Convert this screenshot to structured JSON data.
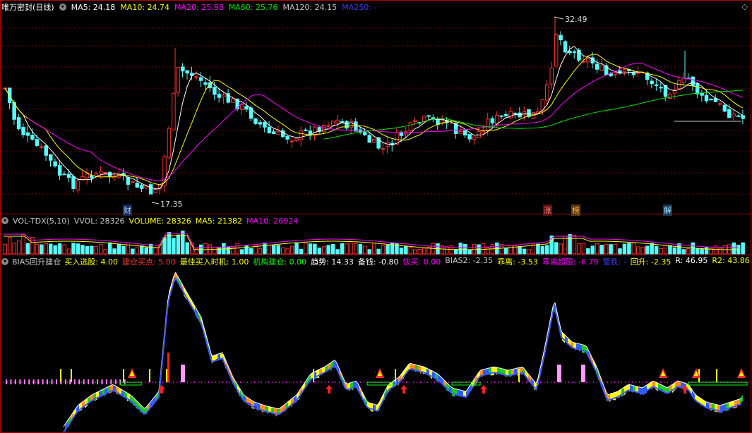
{
  "colors": {
    "up": "#ff3232",
    "down": "#54fcfc",
    "ma5": "#ffffff",
    "ma10": "#ffff00",
    "ma20": "#ff00ff",
    "ma60": "#00e600",
    "ma120": "#c8c8c8",
    "ma250": "#1e1eff",
    "grid": "#7a0000",
    "axis": "#b00000"
  },
  "header": {
    "title": "唯万密封(日线)",
    "ma": [
      {
        "label": "MA5: 24.18",
        "color": "#ffffff"
      },
      {
        "label": "MA10: 24.74",
        "color": "#ffff00"
      },
      {
        "label": "MA20: 25.98",
        "color": "#ff00ff"
      },
      {
        "label": "MA60: 25.76",
        "color": "#00e600"
      },
      {
        "label": "MA120: 24.15",
        "color": "#c8c8c8"
      },
      {
        "label": "MA250: -",
        "color": "#3a3aff"
      }
    ],
    "high_label": "32.49",
    "low_label": "17.35",
    "markers": [
      {
        "text": "财",
        "bg": "#1a2a55",
        "fg": "#9fd0ff"
      },
      {
        "text": "涨",
        "bg": "#5a1010",
        "fg": "#ff8080"
      },
      {
        "text": "榜",
        "bg": "#5a3a10",
        "fg": "#ffb040"
      },
      {
        "text": "解",
        "bg": "#1a3a55",
        "fg": "#9fe0ff"
      }
    ]
  },
  "volume": {
    "title": "VOL-TDX(5,10)",
    "items": [
      {
        "label": "VVOL: 28326",
        "color": "#c8c8c8"
      },
      {
        "label": "VOLUME: 28326",
        "color": "#ffff00"
      },
      {
        "label": "MA5: 21382",
        "color": "#ffff00"
      },
      {
        "label": "MA10: 26924",
        "color": "#ff00ff"
      }
    ]
  },
  "bias": {
    "title": "BIAS回升建仓",
    "items": [
      {
        "label": "买入选股: 4.00",
        "color": "#ffff00"
      },
      {
        "label": "建仓买点: 5.00",
        "color": "#ff3232"
      },
      {
        "label": "最佳买入时机: 1.00",
        "color": "#ffff00"
      },
      {
        "label": "机构建仓: 0.00",
        "color": "#00ff00"
      },
      {
        "label": "趋势: 14.33",
        "color": "#ffffff"
      },
      {
        "label": "备钱: -0.80",
        "color": "#ffffff"
      },
      {
        "label": "快买: 0.00",
        "color": "#ff00ff"
      },
      {
        "label": "BIAS2: -2.35",
        "color": "#c8c8c8"
      },
      {
        "label": "乖离: -3.53",
        "color": "#ffff00"
      },
      {
        "label": "乖离超限: -6.79",
        "color": "#ff00ff"
      },
      {
        "label": "警跌: -",
        "color": "#3a3aff"
      },
      {
        "label": "回升: -2.35",
        "color": "#ffff00"
      },
      {
        "label": "R: 46.95",
        "color": "#ffffff"
      },
      {
        "label": "R2: 43.86",
        "color": "#ffff00"
      }
    ]
  },
  "icons": {
    "collapse": "chevron-down-circle-icon",
    "corner": "diamond-icon"
  }
}
